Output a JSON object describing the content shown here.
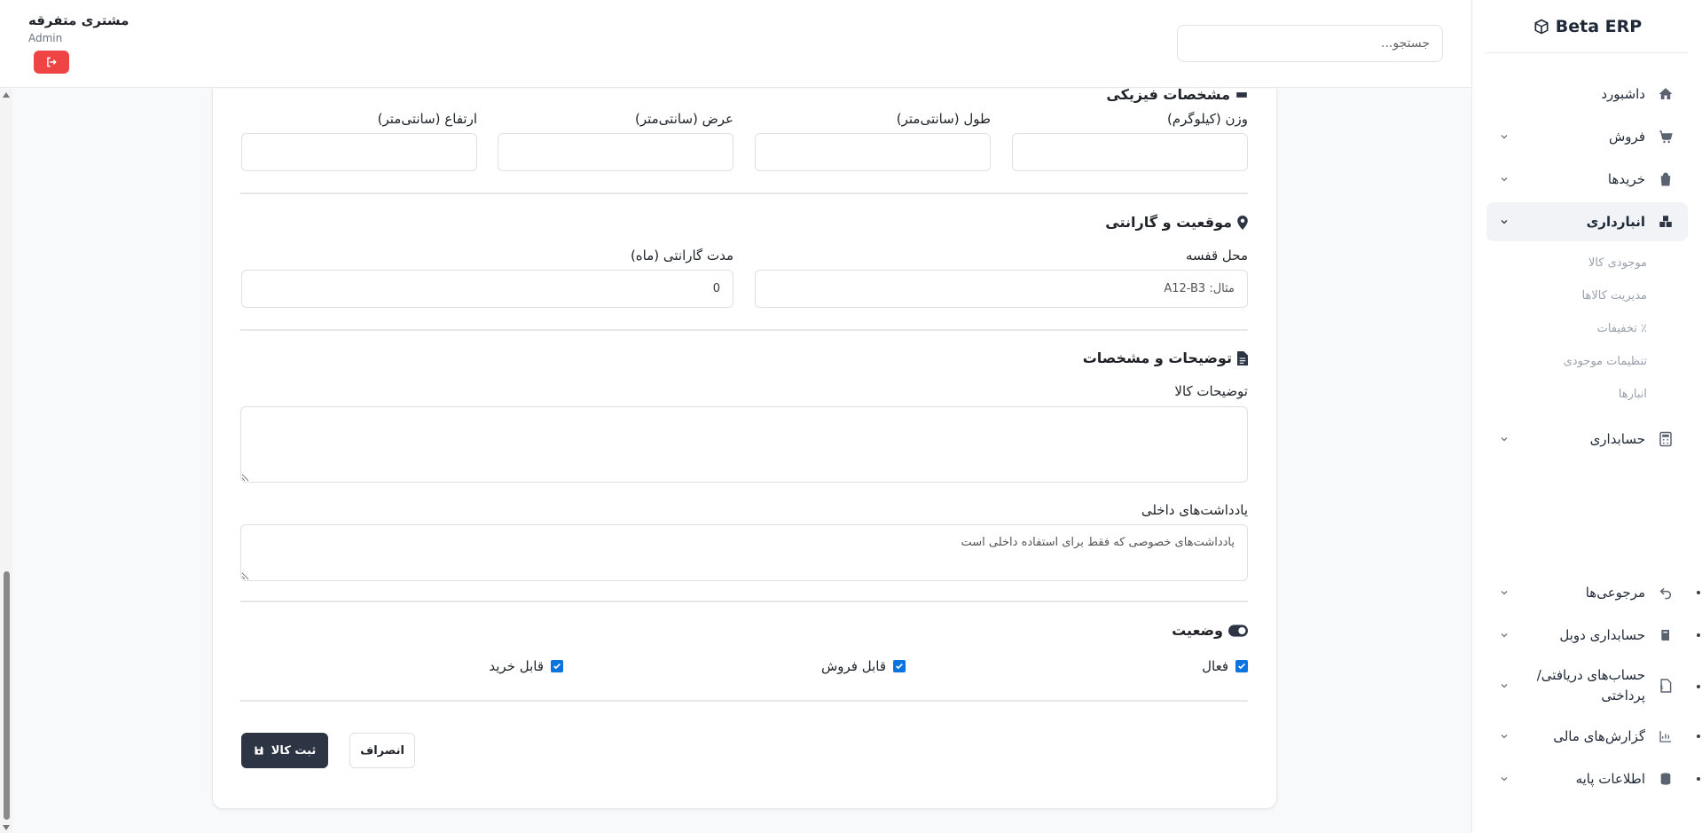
{
  "app": {
    "brand": "Beta ERP"
  },
  "topbar": {
    "search_placeholder": "جستجو...",
    "user_name": "مشتری متفرقه",
    "user_role": "Admin"
  },
  "sidebar": {
    "items": [
      {
        "label": "داشبورد",
        "icon": "home-icon"
      },
      {
        "label": "فروش",
        "icon": "cart-icon"
      },
      {
        "label": "خریدها",
        "icon": "bag-icon"
      },
      {
        "label": "انبارداری",
        "icon": "warehouse-icon",
        "active": true,
        "children": [
          "موجودی کالا",
          "مدیریت کالاها",
          "٪ تخفیفات",
          "تنظیمات موجودی",
          "انبارها"
        ]
      },
      {
        "label": "حسابداری",
        "icon": "calculator-icon"
      },
      {
        "label": "مرجوعی‌ها",
        "icon": "undo-icon"
      },
      {
        "label": "حسابداری دوبل",
        "icon": "book-icon"
      },
      {
        "label": "حساب‌های دریافتی/ پرداختی",
        "icon": "invoice-icon"
      },
      {
        "label": "گزارش‌های مالی",
        "icon": "chart-icon"
      },
      {
        "label": "اطلاعات پایه",
        "icon": "database-icon"
      }
    ]
  },
  "form": {
    "dimensions": {
      "title": "مشخصات فیزیکی",
      "weight_label": "وزن (کیلوگرم)",
      "length_label": "طول (سانتی‌متر)",
      "width_label": "عرض (سانتی‌متر)",
      "height_label": "ارتفاع (سانتی‌متر)"
    },
    "location": {
      "title": "موقعیت و گارانتی",
      "shelf_label": "محل قفسه",
      "shelf_placeholder": "مثال: A12-B3",
      "warranty_label": "مدت گارانتی (ماه)",
      "warranty_value": "0"
    },
    "description": {
      "title": "توضیحات و مشخصات",
      "desc_label": "توضیحات کالا",
      "notes_label": "یادداشت‌های داخلی",
      "notes_placeholder": "یادداشت‌های خصوصی که فقط برای استفاده داخلی است"
    },
    "status": {
      "title": "وضعیت",
      "active_label": "فعال",
      "sellable_label": "قابل فروش",
      "purchasable_label": "قابل خرید",
      "active_checked": true,
      "sellable_checked": true,
      "purchasable_checked": true
    },
    "actions": {
      "submit_label": "ثبت کالا",
      "cancel_label": "انصراف"
    }
  },
  "colors": {
    "primary": "#2d3443",
    "danger": "#ef4444",
    "checkbox": "#0b74de"
  }
}
